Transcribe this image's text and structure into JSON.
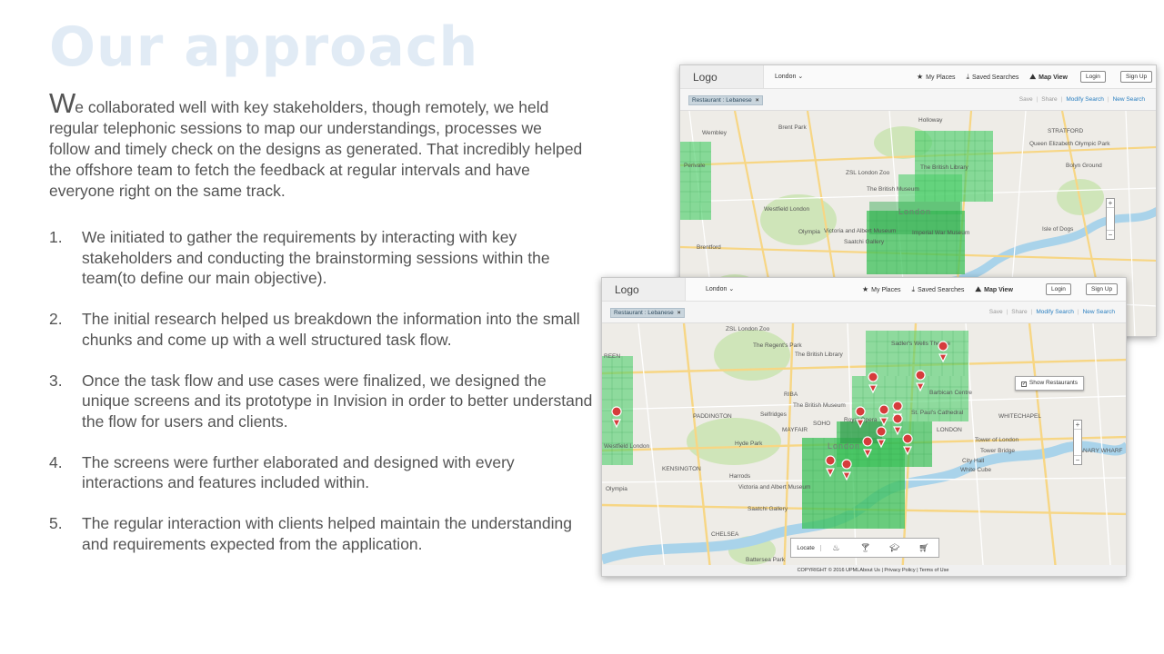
{
  "title": "Our approach",
  "intro": {
    "first_letter": "W",
    "rest": "e collaborated well with key stakeholders, though remotely, we held regular telephonic sessions to map our understandings, processes we follow and timely check on the designs as generated. That incredibly helped the offshore team to fetch the feedback at regular intervals and have everyone right on the same track."
  },
  "steps": [
    {
      "num": "1.",
      "text": "We initiated to gather the requirements by interacting with key stakeholders and conducting the brainstorming sessions within the team(to define our main objective)."
    },
    {
      "num": "2.",
      "text": "The initial research helped us breakdown the information into the small chunks and come up with a well structured task flow."
    },
    {
      "num": "3.",
      "text": "Once the task flow and use cases were finalized, we designed the unique screens and its prototype in Invision in order to better understand the flow for users and clients."
    },
    {
      "num": "4.",
      "text": "The screens were further elaborated and designed with every interactions and features included within."
    },
    {
      "num": "5.",
      "text": "The regular interaction with clients helped maintain the understanding and requirements expected from the application."
    }
  ],
  "mockup": {
    "logo": "Logo",
    "city": "London",
    "nav": {
      "my_places": "My Places",
      "saved_searches": "Saved Searches",
      "map_view": "Map View"
    },
    "login": "Login",
    "signup": "Sign Up",
    "filter_chip": "Restaurant : Lebanese",
    "chip_close": "×",
    "actions": {
      "save": "Save",
      "share": "Share",
      "modify": "Modify Search",
      "new": "New Search"
    },
    "show_restaurants": "Show Restaurants",
    "locate": "Locate",
    "copyright": "COPYRIGHT © 2016 UPMLAbout Us | Privacy Policy | Terms of Use",
    "back_labels": [
      "Holloway",
      "Wembley",
      "Brent Park",
      "STRATFORD",
      "Queen Elizabeth Olympic Park",
      "ZSL London Zoo",
      "The British Library",
      "Bolyn Ground",
      "Perivale",
      "The British Museum",
      "Westfield London",
      "London",
      "Olympia",
      "Victoria and Albert Museum",
      "Imperial War Museum",
      "Isle of Dogs",
      "Brentford",
      "Saatchi Gallery"
    ],
    "front_labels": [
      "ZSL London Zoo",
      "The Regent's Park",
      "The British Library",
      "Sadler's Wells Theatre",
      "REEN",
      "RIBA",
      "The British Museum",
      "Barbican Centre",
      "PADDINGTON",
      "Selfridges",
      "MAYFAIR",
      "SOHO",
      "LONDON",
      "WHITECHAPEL",
      "Westfield London",
      "Hyde Park",
      "London",
      "Tower of London",
      "Tower Bridge",
      "City Hall",
      "KENSINGTON",
      "Harrods",
      "Victoria and Albert Museum",
      "White Cube",
      "Olympia",
      "CANARY WHARF",
      "Saatchi Gallery",
      "CHELSEA",
      "Battersea Park",
      "St. Paul's Cathedral",
      "Royal Opera"
    ]
  },
  "colors": {
    "title": "#e1ebf5",
    "body_text": "#545454",
    "grid_green": "#4fcf6c",
    "link_blue": "#2a7fc0",
    "pin_red": "#d63c3c"
  }
}
